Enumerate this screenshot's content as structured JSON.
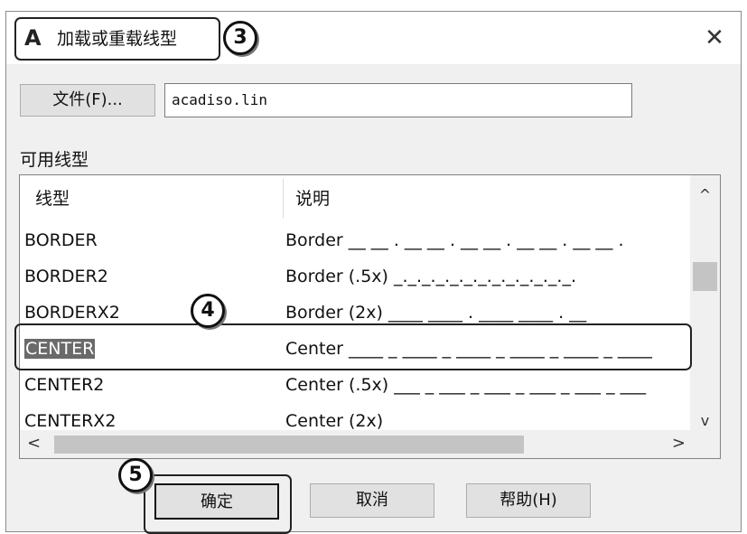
{
  "dialog": {
    "title": "加载或重载线型",
    "app_icon_glyph": "A",
    "close_glyph": "✕"
  },
  "file": {
    "button_label": "文件(F)...",
    "value": "acadiso.lin"
  },
  "linetypes": {
    "group_label": "可用线型",
    "columns": [
      "线型",
      "说明"
    ],
    "rows": [
      {
        "name": "BORDER",
        "description": "Border __ __ . __ __ . __ __ . __ __ . __ __ ."
      },
      {
        "name": "BORDER2",
        "description": "Border (.5x) _._._._._._._._._._._._._."
      },
      {
        "name": "BORDERX2",
        "description": "Border (2x) ____ ____  .  ____ ____  .  __"
      },
      {
        "name": "CENTER",
        "description": "Center ____ _ ____ _ ____ _ ____ _ ____ _ ____"
      },
      {
        "name": "CENTER2",
        "description": "Center (.5x) ___ _ ___ _ ___ _ ___ _ ___ _ ___"
      },
      {
        "name": "CENTERX2",
        "description": "Center (2x)"
      }
    ],
    "selected": "CENTER"
  },
  "scrollbars": {
    "up": "^",
    "down": "v",
    "left": "<",
    "right": ">"
  },
  "buttons": {
    "ok": "确定",
    "cancel": "取消",
    "help": "帮助(H)"
  },
  "callouts": [
    "3",
    "4",
    "5"
  ]
}
